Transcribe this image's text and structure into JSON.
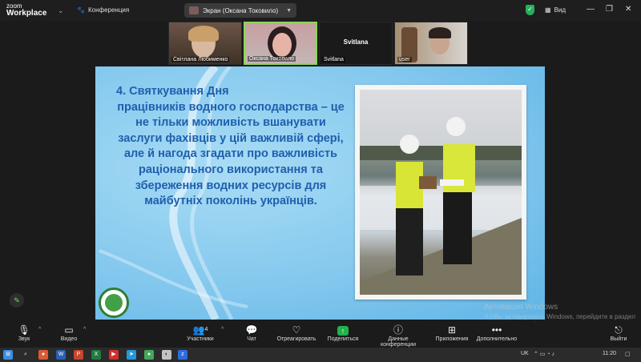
{
  "app": {
    "logo_line1": "zoom",
    "logo_line2": "Workplace",
    "conference_label": "Конференция",
    "screen_share_label": "Экран (Оксана Токовило)",
    "view_label": "Вид"
  },
  "participants": [
    {
      "name": "Світлана Любименко"
    },
    {
      "name": "Оксана Токовило"
    },
    {
      "name": "Svitlana",
      "display_name": "Svitlana"
    },
    {
      "name": "user"
    }
  ],
  "slide": {
    "number": "4.",
    "text_first": "4. Святкування Дня",
    "text_rest": "працівників водного господарства – це не тільки можливість вшанувати заслуги фахівців у цій важливій сфері, але й нагода згадати про важливість раціонального використання та збереження водних ресурсів для майбутніх поколінь українців."
  },
  "watermark": {
    "title": "Активация Windows",
    "subtitle": "Чтобы активировать Windows, перейдите в раздел \"Настройки\", щоб активувати Windows."
  },
  "toolbar": {
    "audio": "Звук",
    "video": "Видео",
    "participants": "Участники",
    "participants_count": "4",
    "chat": "Чат",
    "react": "Отреагировать",
    "share": "Поделиться",
    "data": "Данные конференции",
    "apps": "Приложения",
    "more": "Дополнительно",
    "leave": "Выйти"
  },
  "taskbar": {
    "lang": "UK",
    "time": "11:20"
  },
  "colors": {
    "share_green": "#21b24b",
    "slide_text": "#1f5fae",
    "active_speaker": "#8dd45a"
  }
}
